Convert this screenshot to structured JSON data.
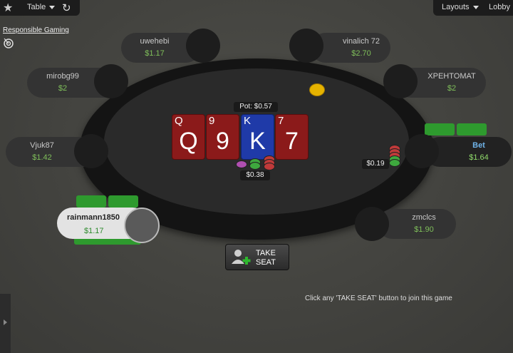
{
  "topbar": {
    "table_label": "Table",
    "layouts_label": "Layouts",
    "lobby_label": "Lobby"
  },
  "responsible_gaming": "Responsible Gaming",
  "seats": [
    {
      "name": "uwehebi",
      "stack": "$1.17"
    },
    {
      "name": "vinalich 72",
      "stack": "$2.70"
    },
    {
      "name": "mirobg99",
      "stack": "$2"
    },
    {
      "name": "XPEHTOMAT",
      "stack": "$2"
    },
    {
      "name": "Vjuk87",
      "stack": "$1.42"
    },
    {
      "name": "Bet",
      "stack": "$1.64"
    },
    {
      "name": "rainmann1850",
      "stack": "$1.17"
    },
    {
      "name": "zmclcs",
      "stack": "$1.90"
    }
  ],
  "board": [
    {
      "rank": "Q",
      "color": "red"
    },
    {
      "rank": "9",
      "color": "red"
    },
    {
      "rank": "K",
      "color": "blue"
    },
    {
      "rank": "7",
      "color": "red"
    }
  ],
  "pot_label": "Pot: $0.57",
  "pot_amount": "$0.38",
  "bet_amount": "$0.19",
  "take_seat": {
    "line1": "TAKE",
    "line2": "SEAT"
  },
  "join_message": "Click any 'TAKE SEAT' button to join this game",
  "colors": {
    "felt": "#2a2a2a",
    "rim": "#141414",
    "stack_green": "#7fbf5a",
    "card_red": "#8b1a1a",
    "card_blue": "#1f3aa8"
  }
}
